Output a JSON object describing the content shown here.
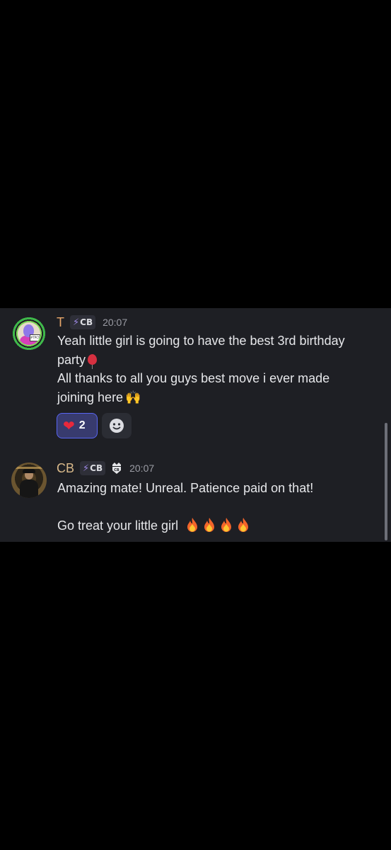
{
  "messages": [
    {
      "username": "T",
      "tag": "CB",
      "timestamp": "20:07",
      "avatar_icon": "alien-sign-avatar",
      "lines": [
        "Yeah little girl is going to have the best 3rd birthday",
        "party",
        "All thanks to all you guys best move i ever made",
        "joining here"
      ],
      "emojis": [
        "balloon",
        "raising-hands"
      ],
      "avatar_sign_text": "#TPCS",
      "reactions": [
        {
          "icon": "heart-icon",
          "count": "2"
        }
      ]
    },
    {
      "username": "CB",
      "tag": "CB",
      "timestamp": "20:07",
      "avatar_icon": "person-avatar",
      "lines": [
        "Amazing mate! Unreal. Patience paid on that!",
        "",
        "Go treat your little girl"
      ],
      "emojis": [
        "fire",
        "fire",
        "fire",
        "fire"
      ]
    }
  ],
  "colors": {
    "panel_bg": "#1e1f24",
    "accent": "#5865f2",
    "username_t": "#e8a76a",
    "username_cb": "#d9b98a"
  }
}
